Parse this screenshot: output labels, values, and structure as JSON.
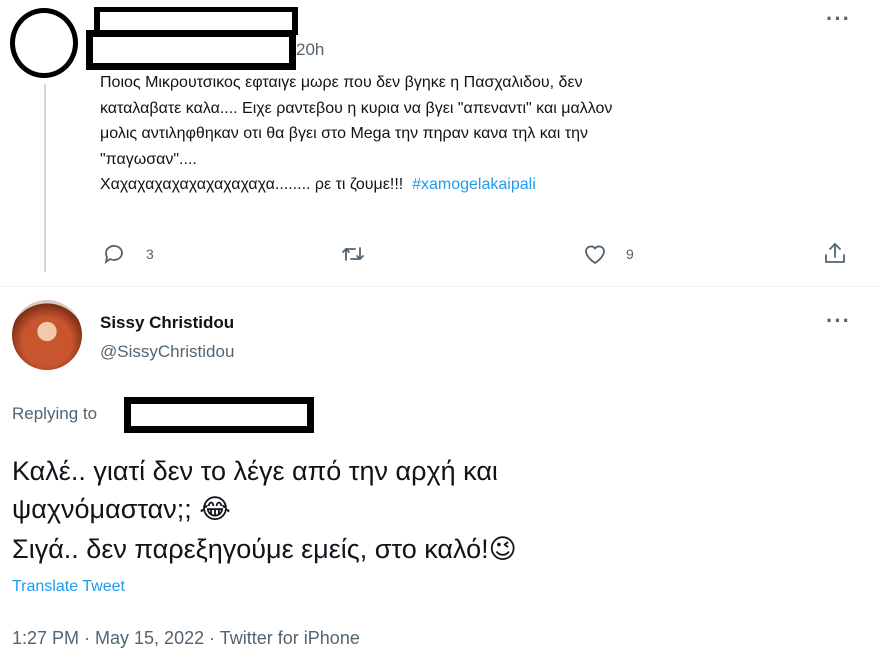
{
  "reply_tweet": {
    "time": "20h",
    "text_lines": [
      "Ποιος Μικρουτσικος εφταιγε μωρε που δεν βγηκε η Πασχαλιδου, δεν",
      "καταλαβατε καλα.... Ειχε ραντεβου η κυρια να βγει \"απεναντι\" και μαλλον",
      "μολις αντιληφθηκαν οτι θα βγει στο Mega την πηραν κανα τηλ και την",
      "\"παγωσαν\"....",
      "Χαχαχαχαχαχαχαχαχαχα........ ρε τι ζουμε!!!"
    ],
    "hashtag": "#xamogelakaipali",
    "actions": {
      "reply_icon": "comment-icon",
      "reply_count": "3",
      "retweet_icon": "retweet-icon",
      "like_icon": "heart-icon",
      "like_count": "9",
      "share_icon": "share-icon"
    },
    "more_icon": "more-options-icon"
  },
  "main_tweet": {
    "name": "Sissy Christidou",
    "handle": "@SissyChristidou",
    "replying_to": "Replying to",
    "line1": "Καλέ.. γιατί δεν το λέγε από την αρχή και",
    "line2": "ψαχνόμασταν;;",
    "line3": "Σιγά.. δεν παρεξηγούμε εμείς, στο καλό!",
    "emoji_laugh": "😂",
    "emoji_wink": "😉",
    "translate": "Translate Tweet",
    "meta": "1:27 PM · May 15, 2022 · Twitter for iPhone",
    "more_icon": "more-options-icon"
  },
  "colors": {
    "link": "#1d9bf0",
    "secondary": "#536471",
    "text": "#0f1419"
  }
}
